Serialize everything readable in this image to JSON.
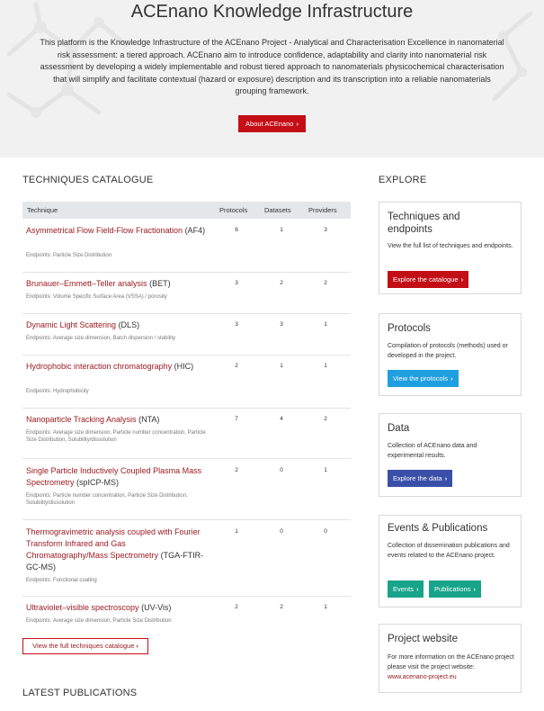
{
  "hero": {
    "title": "ACEnano Knowledge Infrastructure",
    "description": "This platform is the Knowledge Infrastructure of the ACEnano Project - Analytical and Characterisation Excellence in nanomaterial risk assessment: a tiered approach. ACEnano aim to introduce confidence, adaptability and clarity into nanomaterial risk assessment by developing a widely implementable and robust tiered approach to nanomaterials physicochemical characterisation that will simplify and facilitate contextual (hazard or exposure) description and its transcription into a reliable nanomaterials grouping framework.",
    "button_label": "About ACEnano"
  },
  "catalogue": {
    "title": "TECHNIQUES CATALOGUE",
    "columns": {
      "technique": "Technique",
      "protocols": "Protocols",
      "datasets": "Datasets",
      "providers": "Providers"
    },
    "rows": [
      {
        "name": "Asymmetrical Flow Field-Flow Fractionation",
        "abbr": "(AF4)",
        "endpoints": "Endpoints: Particle Size Distribution",
        "protocols": "6",
        "datasets": "1",
        "providers": "3"
      },
      {
        "name": "Brunauer–Emmett–Teller analysis",
        "abbr": "(BET)",
        "endpoints": "Endpoints: Volume Specific Surface Area (VSSA) / porosity",
        "protocols": "3",
        "datasets": "2",
        "providers": "2"
      },
      {
        "name": "Dynamic Light Scattering",
        "abbr": "(DLS)",
        "endpoints": "Endpoints: Average size dimension, Batch dispersion / stability",
        "protocols": "3",
        "datasets": "3",
        "providers": "1"
      },
      {
        "name": "Hydrophobic interaction chromatography",
        "abbr": "(HIC)",
        "endpoints": "Endpoints: Hydrophobicity",
        "protocols": "2",
        "datasets": "1",
        "providers": "1"
      },
      {
        "name": "Nanoparticle Tracking Analysis",
        "abbr": "(NTA)",
        "endpoints": "Endpoints: Average size dimension, Particle number concentration, Particle Size Distribution, Solubility/dissolution",
        "protocols": "7",
        "datasets": "4",
        "providers": "2"
      },
      {
        "name": "Single Particle Inductively Coupled Plasma Mass Spectrometry",
        "abbr": "(spICP-MS)",
        "endpoints": "Endpoints: Particle number concentration, Particle Size Distribution, Solubility/dissolution",
        "protocols": "2",
        "datasets": "0",
        "providers": "1"
      },
      {
        "name": "Thermogravimetric analysis coupled with Fourier Transform Infrared and Gas Chromatography/Mass Spectrometry",
        "abbr": "(TGA-FTIR-GC-MS)",
        "endpoints": "Endpoints: Functional coating",
        "protocols": "1",
        "datasets": "0",
        "providers": "0"
      },
      {
        "name": "Ultraviolet–visible spectroscopy",
        "abbr": "(UV-Vis)",
        "endpoints": "Endpoints: Average size dimension, Particle Size Distribution",
        "protocols": "2",
        "datasets": "2",
        "providers": "1"
      }
    ],
    "view_all_label": "View the full techniques catalogue"
  },
  "publications": {
    "title": "LATEST PUBLICATIONS"
  },
  "explore": {
    "title": "EXPLORE",
    "cards": [
      {
        "title": "Techniques and endpoints",
        "desc": "View the full list of techniques and endpoints.",
        "button": "Explore the catalogue"
      },
      {
        "title": "Protocols",
        "desc": "Compilation of protocols (methods) used or developed in the project.",
        "button": "View the protocols"
      },
      {
        "title": "Data",
        "desc": "Collection of ACEnano data and experimental results.",
        "button": "Explore the data"
      },
      {
        "title": "Events & Publications",
        "desc": "Collection of dissemination publications and events related to the ACEnano project.",
        "button_events": "Events",
        "button_publications": "Publications"
      },
      {
        "title": "Project website",
        "desc": "For more information on the ACEnano project please visit the project website:",
        "link": "www.acenano-project.eu"
      }
    ]
  },
  "colors": {
    "primary_red": "#c40e16",
    "link_red": "#9b1b22",
    "blue": "#1e9fe0",
    "indigo": "#3a50a8",
    "teal": "#17a489"
  },
  "icons": {
    "chevron": "chevron-right-icon"
  }
}
